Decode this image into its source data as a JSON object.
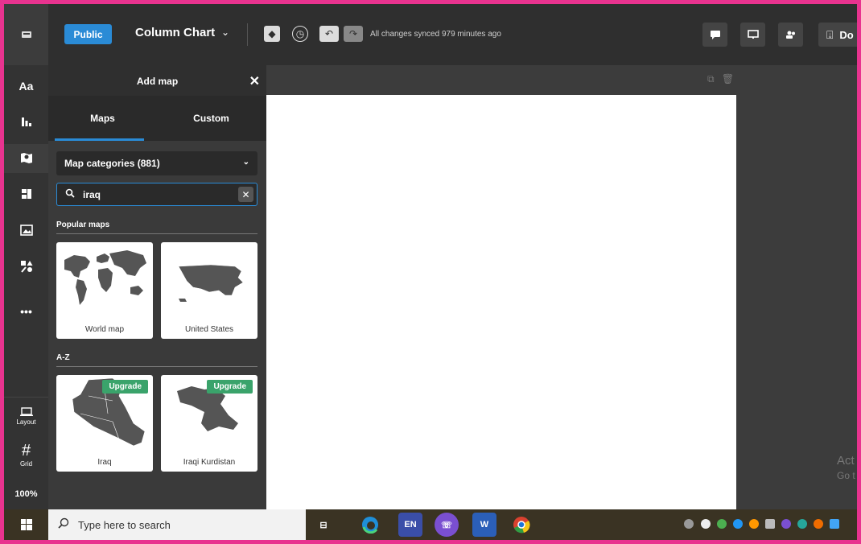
{
  "topbar": {
    "public_label": "Public",
    "doc_title": "Column Chart",
    "sync_text": "All changes synced 979 minutes ago",
    "download_label": "Do"
  },
  "rail": {
    "items": [
      {
        "name": "text",
        "label": "Aa"
      },
      {
        "name": "charts",
        "label": "ılı"
      },
      {
        "name": "maps",
        "label": "◈"
      },
      {
        "name": "layout-blocks",
        "label": "▤"
      },
      {
        "name": "images",
        "label": "▨"
      },
      {
        "name": "shapes",
        "label": "◧"
      },
      {
        "name": "more",
        "label": "•••"
      }
    ],
    "layout_label": "Layout",
    "grid_label": "Grid",
    "zoom": "100%"
  },
  "panel": {
    "title": "Add map",
    "tabs": [
      {
        "label": "Maps",
        "active": true
      },
      {
        "label": "Custom",
        "active": false
      }
    ],
    "categories_label": "Map categories (881)",
    "search_value": "iraq",
    "popular_label": "Popular maps",
    "popular": [
      {
        "label": "World map"
      },
      {
        "label": "United States"
      }
    ],
    "az_label": "A-Z",
    "az_maps": [
      {
        "label": "Iraq",
        "badge": "Upgrade"
      },
      {
        "label": "Iraqi Kurdistan",
        "badge": "Upgrade"
      }
    ]
  },
  "canvas": {
    "watermark_line1": "Act",
    "watermark_line2": "Go t"
  },
  "taskbar": {
    "search_placeholder": "Type here to search",
    "lang": "EN"
  },
  "colors": {
    "accent": "#2a8bd6",
    "upgrade": "#3aa36b",
    "frame": "#e8338f"
  }
}
